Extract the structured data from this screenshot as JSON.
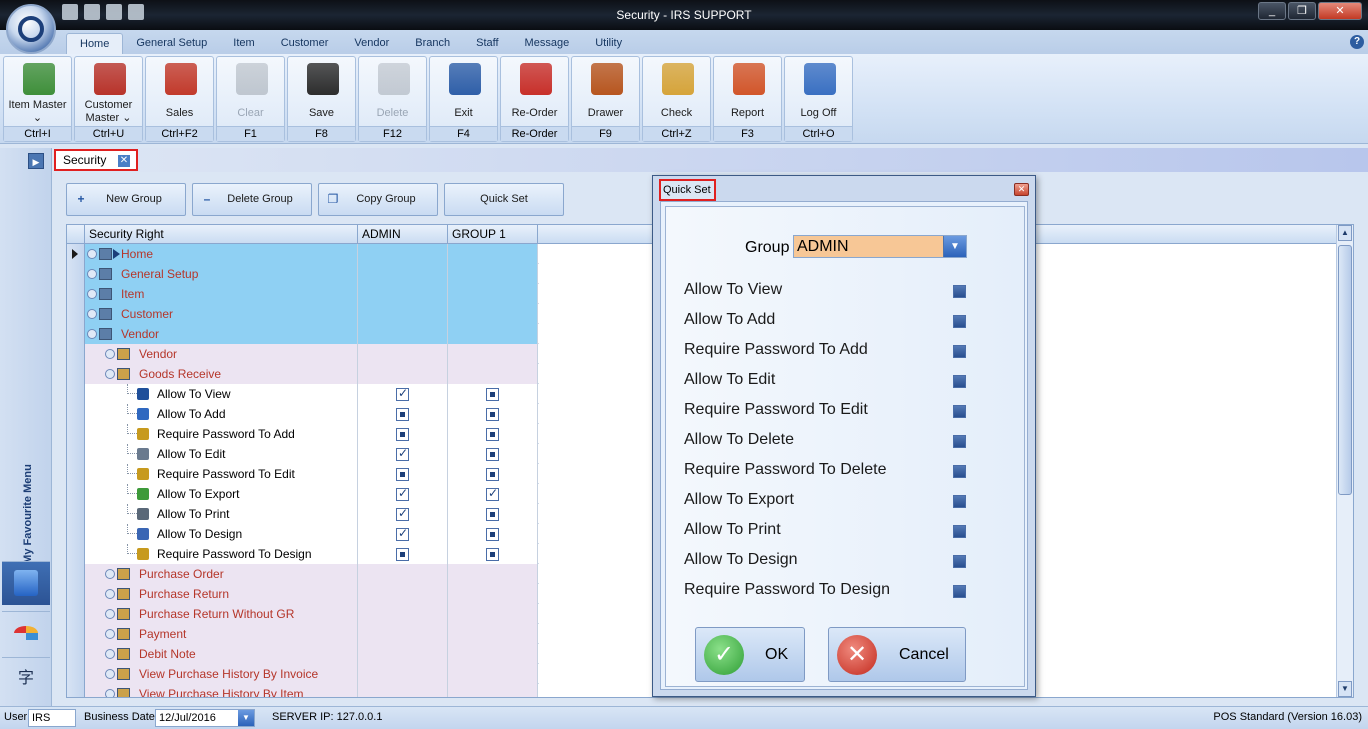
{
  "window": {
    "title": "Security - IRS SUPPORT",
    "controls": [
      "_",
      "❐",
      "✕"
    ]
  },
  "ribbon_tabs": [
    "Home",
    "General Setup",
    "Item",
    "Customer",
    "Vendor",
    "Branch",
    "Staff",
    "Message",
    "Utility"
  ],
  "ribbon_buttons": [
    {
      "label": "Item Master ⌄",
      "key": "Ctrl+I",
      "icon": "item-master-icon",
      "color": "#3f8f3a"
    },
    {
      "label": "Customer Master ⌄",
      "key": "Ctrl+U",
      "icon": "customer-master-icon",
      "color": "#b8332a"
    },
    {
      "label": "Sales",
      "key": "Ctrl+F2",
      "icon": "sales-cart-icon",
      "color": "#c23a2b"
    },
    {
      "label": "Clear",
      "key": "F1",
      "icon": "clear-icon",
      "color": "#9ca4ad",
      "disabled": true
    },
    {
      "label": "Save",
      "key": "F8",
      "icon": "save-disk-icon",
      "color": "#2d2d2d"
    },
    {
      "label": "Delete",
      "key": "F12",
      "icon": "delete-bin-icon",
      "color": "#a2a9b2",
      "disabled": true
    },
    {
      "label": "Exit",
      "key": "F4",
      "icon": "exit-door-icon",
      "color": "#2f5fa8"
    },
    {
      "label": "Re-Order",
      "key": "Re-Order",
      "icon": "reorder-basket-icon",
      "color": "#c8302a"
    },
    {
      "label": "Drawer",
      "key": "F9",
      "icon": "drawer-icon",
      "color": "#b7561f"
    },
    {
      "label": "Check",
      "key": "Ctrl+Z",
      "icon": "check-list-icon",
      "color": "#d6a43a"
    },
    {
      "label": "Report",
      "key": "F3",
      "icon": "report-chart-icon",
      "color": "#d2562a"
    },
    {
      "label": "Log Off",
      "key": "Ctrl+O",
      "icon": "log-off-lock-icon",
      "color": "#3a70c2"
    }
  ],
  "doc_tab": {
    "label": "Security",
    "close": "✕"
  },
  "favourite_menu": {
    "label": "My Favourite Menu",
    "toggle": "▶",
    "glyph": "字"
  },
  "toolbar": {
    "new_group": "New Group",
    "delete_group": "Delete Group",
    "copy_group": "Copy Group",
    "quick_set": "Quick Set"
  },
  "grid": {
    "headers": [
      "Security Right",
      "ADMIN",
      "GROUP 1"
    ],
    "rows": [
      {
        "label": "Home",
        "level": 0,
        "current": true
      },
      {
        "label": "General Setup",
        "level": 0
      },
      {
        "label": "Item",
        "level": 0
      },
      {
        "label": "Customer",
        "level": 0
      },
      {
        "label": "Vendor",
        "level": 0
      },
      {
        "label": "Vendor",
        "level": 1
      },
      {
        "label": "Goods Receive",
        "level": 1
      },
      {
        "label": "Allow To View",
        "level": 2,
        "admin": "on",
        "group1": "ind",
        "icon": "#1f4f9a"
      },
      {
        "label": "Allow To Add",
        "level": 2,
        "admin": "ind",
        "group1": "ind",
        "icon": "#2f68c0"
      },
      {
        "label": "Require Password To Add",
        "level": 2,
        "admin": "ind",
        "group1": "ind",
        "icon": "#c79a1e"
      },
      {
        "label": "Allow To Edit",
        "level": 2,
        "admin": "on",
        "group1": "ind",
        "icon": "#6a7a8e"
      },
      {
        "label": "Require Password To Edit",
        "level": 2,
        "admin": "ind",
        "group1": "ind",
        "icon": "#c79a1e"
      },
      {
        "label": "Allow To Export",
        "level": 2,
        "admin": "on",
        "group1": "on",
        "icon": "#3d9a3a"
      },
      {
        "label": "Allow To Print",
        "level": 2,
        "admin": "on",
        "group1": "ind",
        "icon": "#5a6878"
      },
      {
        "label": "Allow To Design",
        "level": 2,
        "admin": "on",
        "group1": "ind",
        "icon": "#3a66b4"
      },
      {
        "label": "Require Password To Design",
        "level": 2,
        "admin": "ind",
        "group1": "ind",
        "icon": "#c79a1e"
      },
      {
        "label": "Purchase Order",
        "level": 1
      },
      {
        "label": "Purchase Return",
        "level": 1
      },
      {
        "label": "Purchase Return Without GR",
        "level": 1
      },
      {
        "label": "Payment",
        "level": 1
      },
      {
        "label": "Debit Note",
        "level": 1
      },
      {
        "label": "View Purchase History By Invoice",
        "level": 1
      },
      {
        "label": "View Purchase History By Item",
        "level": 1
      }
    ]
  },
  "dialog": {
    "title": "Quick Set",
    "close": "✕",
    "group_label": "Group",
    "group_value": "ADMIN",
    "options": [
      "Allow To View",
      "Allow To Add",
      "Require Password To Add",
      "Allow To Edit",
      "Require Password To Edit",
      "Allow To Delete",
      "Require Password To Delete",
      "Allow To Export",
      "Allow To Print",
      "Allow To Design",
      "Require Password To Design"
    ],
    "ok_label": "OK",
    "cancel_label": "Cancel"
  },
  "statusbar": {
    "user_label": "User",
    "user_value": "IRS",
    "business_date_label": "Business Date",
    "business_date_value": "12/Jul/2016",
    "server_ip": "SERVER IP: 127.0.0.1",
    "version": "POS Standard (Version 16.03)"
  }
}
